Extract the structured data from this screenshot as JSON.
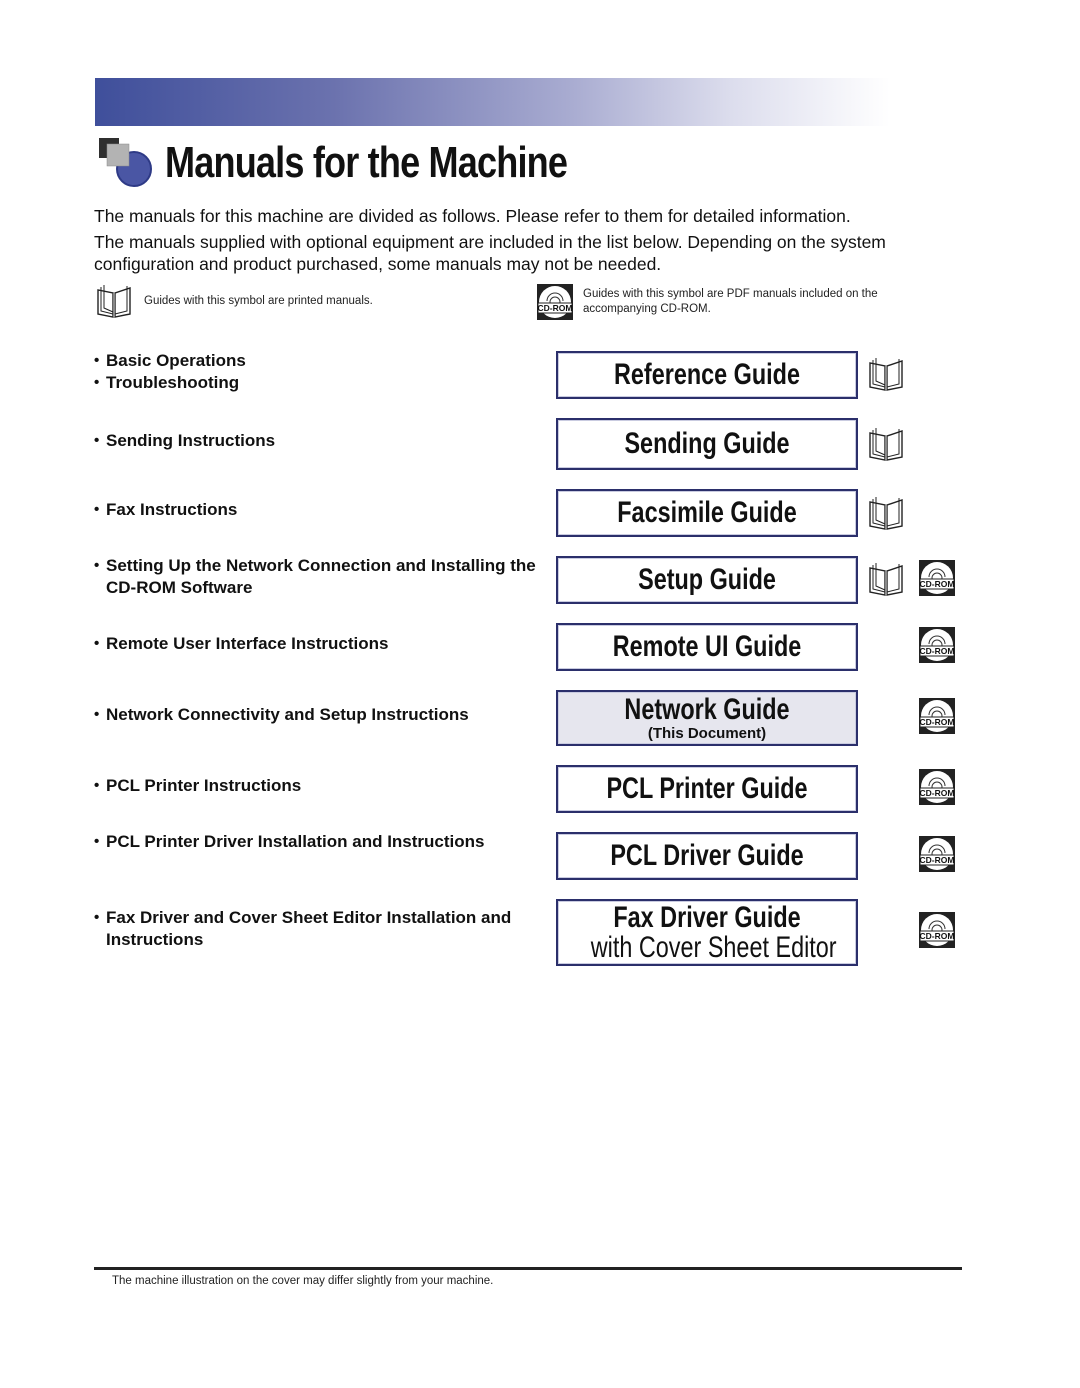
{
  "header": {
    "title": "Manuals for the Machine",
    "band_colors": [
      "#3f4f9b",
      "#ffffff"
    ]
  },
  "intro": {
    "line1": "The manuals for this machine are divided as follows. Please refer to them for detailed information.",
    "line2": "The manuals supplied with optional equipment are included in the list below. Depending on the system configuration and product purchased, some manuals may not be needed."
  },
  "legend": {
    "printed": {
      "icon": "book-icon",
      "text": "Guides with this symbol are printed manuals."
    },
    "cdrom": {
      "icon": "cd-rom-icon",
      "text": "Guides with this symbol are PDF manuals included on the accompanying CD-ROM."
    }
  },
  "manuals": [
    {
      "descriptions": [
        "Basic Operations",
        "Troubleshooting"
      ],
      "guide": "Reference Guide",
      "printed": true,
      "cdrom": false
    },
    {
      "descriptions": [
        "Sending Instructions"
      ],
      "guide": "Sending Guide",
      "printed": true,
      "cdrom": false
    },
    {
      "descriptions": [
        "Fax Instructions"
      ],
      "guide": "Facsimile Guide",
      "printed": true,
      "cdrom": false
    },
    {
      "descriptions": [
        "Setting Up the Network Connection and Installing the CD-ROM Software"
      ],
      "guide": "Setup Guide",
      "printed": true,
      "cdrom": true
    },
    {
      "descriptions": [
        "Remote User Interface Instructions"
      ],
      "guide": "Remote UI Guide",
      "printed": false,
      "cdrom": true
    },
    {
      "descriptions": [
        "Network Connectivity and Setup Instructions"
      ],
      "guide": "Network Guide",
      "guide_sub": "(This Document)",
      "current": true,
      "printed": false,
      "cdrom": true
    },
    {
      "descriptions": [
        "PCL Printer Instructions"
      ],
      "guide": "PCL Printer Guide",
      "printed": false,
      "cdrom": true
    },
    {
      "descriptions": [
        "PCL Printer Driver Installation and Instructions"
      ],
      "guide": "PCL Driver Guide",
      "printed": false,
      "cdrom": true
    },
    {
      "descriptions": [
        "Fax Driver and Cover Sheet Editor Installation and Instructions"
      ],
      "guide": "Fax Driver Guide",
      "guide_sub2": "with Cover Sheet Editor",
      "printed": false,
      "cdrom": true
    }
  ],
  "cd_icon_label": "CD-ROM",
  "bullet": "•",
  "footer": {
    "note": "The machine illustration on the cover may differ slightly from your machine."
  }
}
